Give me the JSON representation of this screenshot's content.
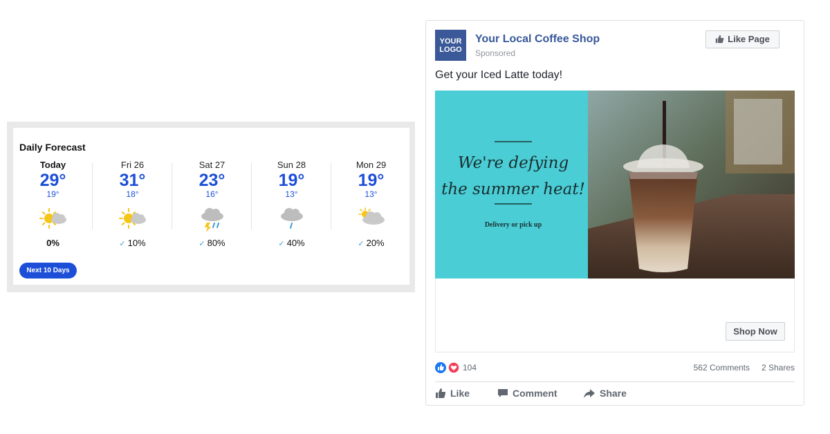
{
  "weather": {
    "title": "Daily Forecast",
    "days": [
      {
        "label": "Today",
        "high": "29°",
        "low": "19°",
        "icon": "partly-sunny-icon",
        "precip": "0%"
      },
      {
        "label": "Fri 26",
        "high": "31°",
        "low": "18°",
        "icon": "partly-sunny-icon",
        "precip": "10%"
      },
      {
        "label": "Sat 27",
        "high": "23°",
        "low": "16°",
        "icon": "thunderstorm-icon",
        "precip": "80%"
      },
      {
        "label": "Sun 28",
        "high": "19°",
        "low": "13°",
        "icon": "rain-cloud-icon",
        "precip": "40%"
      },
      {
        "label": "Mon 29",
        "high": "19°",
        "low": "13°",
        "icon": "mostly-cloudy-icon",
        "precip": "20%"
      }
    ],
    "next_button": "Next 10 Days",
    "colors": {
      "accent": "#1d4ed8",
      "sun": "#f5c518",
      "cloud": "#c7c7c7",
      "rain": "#3b9bd8"
    }
  },
  "ad": {
    "logo_line1": "YOUR",
    "logo_line2": "LOGO",
    "page_name": "Your Local Coffee Shop",
    "sponsored": "Sponsored",
    "like_page": "Like Page",
    "post_text": "Get your Iced Latte today!",
    "image_headline_1": "We're defying",
    "image_headline_2": "the summer heat!",
    "image_subtext": "Delivery or pick up",
    "cta": "Shop Now",
    "reaction_count": "104",
    "comments": "562 Comments",
    "shares": "2 Shares",
    "actions": {
      "like": "Like",
      "comment": "Comment",
      "share": "Share"
    },
    "colors": {
      "brand": "#3b5998",
      "link": "#365899",
      "teal": "#4fd1d9"
    }
  }
}
